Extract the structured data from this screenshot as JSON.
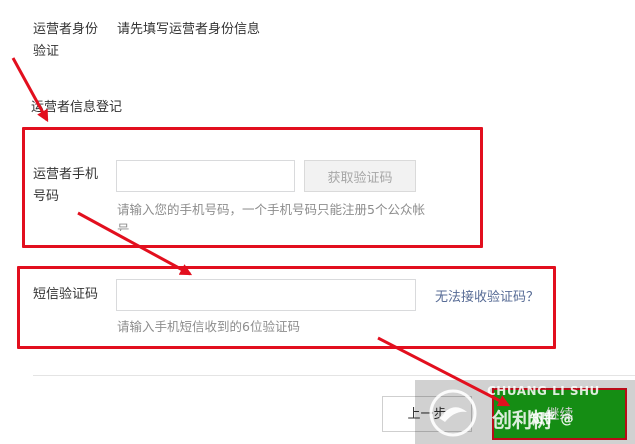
{
  "identity": {
    "label_line1": "运营者身份",
    "label_line2": "验证",
    "value": "请先填写运营者身份信息"
  },
  "section": {
    "title": "运营者信息登记"
  },
  "phone": {
    "label_line1": "运营者手机",
    "label_line2": "号码",
    "input_value": "",
    "get_code_label": "获取验证码",
    "help_line1": "请输入您的手机号码，一个手机号码只能注册5个公众帐",
    "help_line2": "号。"
  },
  "sms": {
    "label": "短信验证码",
    "input_value": "",
    "cant_receive_link": "无法接收验证码？",
    "help": "请输入手机短信收到的6位验证码"
  },
  "footer": {
    "back_label": "上一步",
    "next_label": "继续"
  },
  "watermark": {
    "brand_en": "CHUANG LI SHU",
    "brand_cn": "创利树",
    "zhihu": "知乎 @"
  },
  "colors": {
    "annotation_red": "#e20f1e",
    "primary_green": "#1aad19",
    "link_blue": "#576b95",
    "help_gray": "#8d8d8d"
  }
}
